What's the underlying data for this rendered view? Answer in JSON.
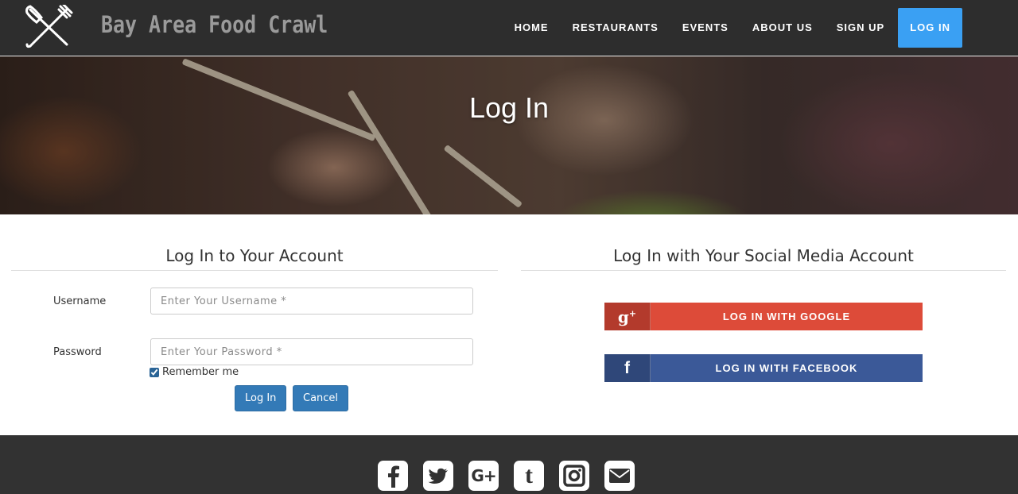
{
  "navbar": {
    "brand": "Bay Area Food Crawl",
    "items": [
      {
        "label": "HOME"
      },
      {
        "label": "RESTAURANTS"
      },
      {
        "label": "EVENTS"
      },
      {
        "label": "ABOUT US"
      },
      {
        "label": "SIGN UP"
      },
      {
        "label": "LOG IN",
        "active": true
      }
    ],
    "active_color": "#3aa0f3",
    "background": "#2d2d2d"
  },
  "hero": {
    "title": "Log In"
  },
  "login_form": {
    "heading": "Log In to Your Account",
    "username_label": "Username",
    "username_placeholder": "Enter Your Username *",
    "password_label": "Password",
    "password_placeholder": "Enter Your Password *",
    "remember_label": "Remember me",
    "remember_checked": true,
    "login_button": "Log In",
    "cancel_button": "Cancel",
    "button_color": "#337ab7"
  },
  "social_login": {
    "heading": "Log In with Your Social Media Account",
    "google": {
      "label": "LOG IN WITH GOOGLE",
      "icon": "google-plus-icon",
      "color": "#dd4b39",
      "icon_color": "#b33a2c"
    },
    "facebook": {
      "label": "LOG IN WITH FACEBOOK",
      "icon": "facebook-icon",
      "color": "#3b5998",
      "icon_color": "#2f4779"
    }
  },
  "footer": {
    "icons": [
      "facebook-icon",
      "twitter-icon",
      "google-plus-icon",
      "tumblr-icon",
      "instagram-icon",
      "email-icon"
    ],
    "background": "#323232"
  }
}
